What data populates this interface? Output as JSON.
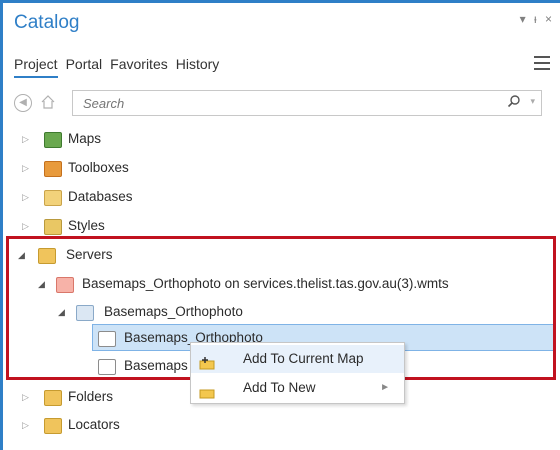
{
  "pane": {
    "title": "Catalog",
    "controls": {
      "dropdown": "▾",
      "pin": "ᵼ",
      "close": "×"
    }
  },
  "tabs": [
    {
      "label": "Project",
      "active": true
    },
    {
      "label": "Portal"
    },
    {
      "label": "Favorites"
    },
    {
      "label": "History"
    }
  ],
  "search": {
    "placeholder": "Search"
  },
  "tree": {
    "maps": "Maps",
    "toolboxes": "Toolboxes",
    "databases": "Databases",
    "styles": "Styles",
    "servers": "Servers",
    "wmts_connection": "Basemaps_Orthophoto on services.thelist.tas.gov.au(3).wmts",
    "service": "Basemaps_Orthophoto",
    "layer_1": "Basemaps_Orthophoto",
    "layer_2": "Basemaps",
    "folders": "Folders",
    "locators": "Locators"
  },
  "context_menu": {
    "items": [
      {
        "label": "Add To Current Map"
      },
      {
        "label": "Add To New",
        "has_submenu": true
      }
    ]
  },
  "colors": {
    "accent": "#2f7fc7",
    "highlight_border": "#c1121f",
    "selection": "#cde3f7"
  }
}
